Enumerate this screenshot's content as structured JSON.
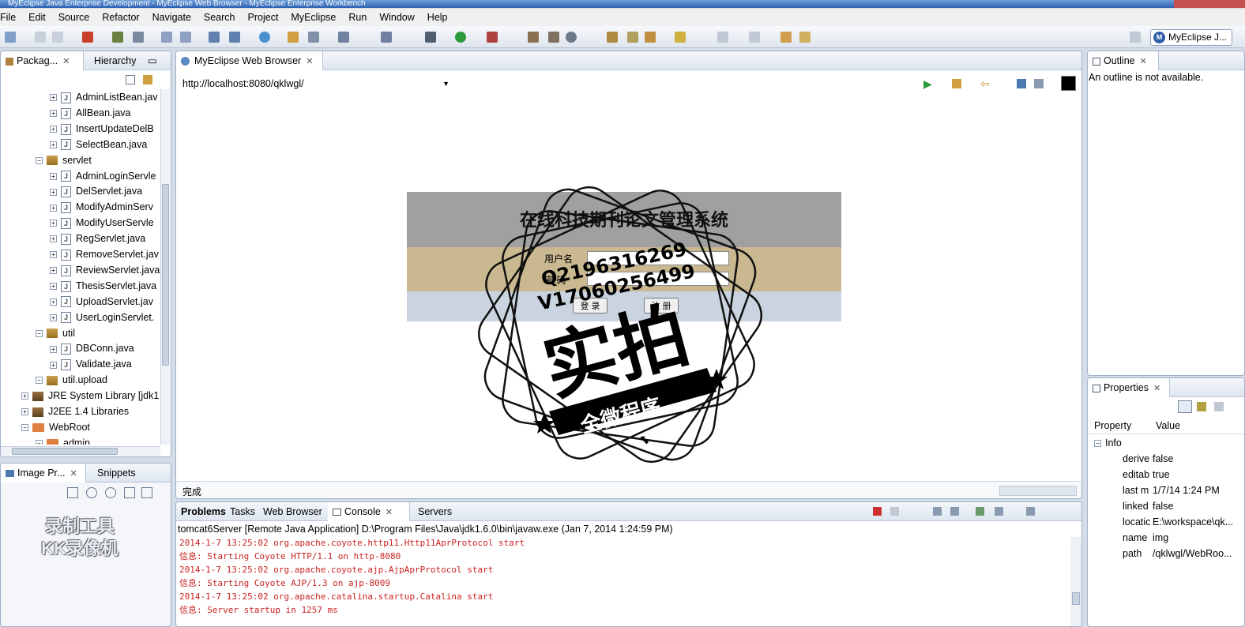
{
  "window": {
    "title": "MyEclipse Java Enterprise Development - MyEclipse Web Browser - MyEclipse Enterprise Workbench"
  },
  "menu": [
    "File",
    "Edit",
    "Source",
    "Refactor",
    "Navigate",
    "Search",
    "Project",
    "MyEclipse",
    "Run",
    "Window",
    "Help"
  ],
  "perspective": {
    "label": "MyEclipse J..."
  },
  "left_top": {
    "tabs": [
      "Packag...",
      "Hierarchy"
    ],
    "tree": [
      {
        "label": "AdminListBean.jav",
        "kind": "java",
        "indent": 2
      },
      {
        "label": "AllBean.java",
        "kind": "java",
        "indent": 2
      },
      {
        "label": "InsertUpdateDelB",
        "kind": "java",
        "indent": 2
      },
      {
        "label": "SelectBean.java",
        "kind": "java",
        "indent": 2
      },
      {
        "label": "servlet",
        "kind": "pkg",
        "indent": 1
      },
      {
        "label": "AdminLoginServle",
        "kind": "java",
        "indent": 2
      },
      {
        "label": "DelServlet.java",
        "kind": "java",
        "indent": 2
      },
      {
        "label": "ModifyAdminServ",
        "kind": "java",
        "indent": 2
      },
      {
        "label": "ModifyUserServle",
        "kind": "java",
        "indent": 2
      },
      {
        "label": "RegServlet.java",
        "kind": "java",
        "indent": 2
      },
      {
        "label": "RemoveServlet.jav",
        "kind": "java",
        "indent": 2
      },
      {
        "label": "ReviewServlet.java",
        "kind": "java",
        "indent": 2
      },
      {
        "label": "ThesisServlet.java",
        "kind": "java",
        "indent": 2
      },
      {
        "label": "UploadServlet.jav",
        "kind": "java",
        "indent": 2
      },
      {
        "label": "UserLoginServlet.",
        "kind": "java",
        "indent": 2
      },
      {
        "label": "util",
        "kind": "pkg",
        "indent": 1
      },
      {
        "label": "DBConn.java",
        "kind": "java",
        "indent": 2
      },
      {
        "label": "Validate.java",
        "kind": "java",
        "indent": 2
      },
      {
        "label": "util.upload",
        "kind": "pkg",
        "indent": 1
      },
      {
        "label": "JRE System Library [jdk1",
        "kind": "lib",
        "indent": 0
      },
      {
        "label": "J2EE 1.4 Libraries",
        "kind": "lib",
        "indent": 0
      },
      {
        "label": "WebRoot",
        "kind": "folder",
        "indent": 0
      },
      {
        "label": "admin",
        "kind": "folder",
        "indent": 1
      }
    ]
  },
  "left_bottom": {
    "tabs": [
      "Image Pr...",
      "Snippets"
    ],
    "watermark": [
      "录制工具",
      "KK录像机"
    ]
  },
  "browser": {
    "tab": "MyEclipse Web Browser",
    "url": "http://localhost:8080/qklwgl/",
    "status": "完成",
    "page_title": "在线科技期刊论文管理系统",
    "login_labels": [
      "用户名",
      "密 码"
    ],
    "buttons": [
      "登 录",
      "注 册"
    ]
  },
  "stamp": {
    "line1": "Q2196316269",
    "line2": "V17060256499",
    "big": "实拍",
    "ribbon": "全微程序"
  },
  "outline": {
    "tab": "Outline",
    "message": "An outline is not available."
  },
  "properties": {
    "tab": "Properties",
    "headers": [
      "Property",
      "Value"
    ],
    "group": "Info",
    "rows": [
      {
        "k": "derive",
        "v": "false"
      },
      {
        "k": "editab",
        "v": "true"
      },
      {
        "k": "last m",
        "v": "1/7/14 1:24 PM"
      },
      {
        "k": "linked",
        "v": "false"
      },
      {
        "k": "locatic",
        "v": "E:\\workspace\\qk..."
      },
      {
        "k": "name",
        "v": "img"
      },
      {
        "k": "path",
        "v": "/qklwgl/WebRoo..."
      }
    ]
  },
  "console": {
    "tabs": [
      "Problems",
      "Tasks",
      "Web Browser",
      "Console",
      "Servers"
    ],
    "header": "tomcat6Server [Remote Java Application] D:\\Program Files\\Java\\jdk1.6.0\\bin\\javaw.exe (Jan 7, 2014 1:24:59 PM)",
    "lines": [
      "2014-1-7 13:25:02 org.apache.coyote.http11.Http11AprProtocol start",
      "信息: Starting Coyote HTTP/1.1 on http-8080",
      "2014-1-7 13:25:02 org.apache.coyote.ajp.AjpAprProtocol start",
      "信息: Starting Coyote AJP/1.3 on ajp-8009",
      "2014-1-7 13:25:02 org.apache.catalina.startup.Catalina start",
      "信息: Server startup in 1257 ms"
    ]
  }
}
